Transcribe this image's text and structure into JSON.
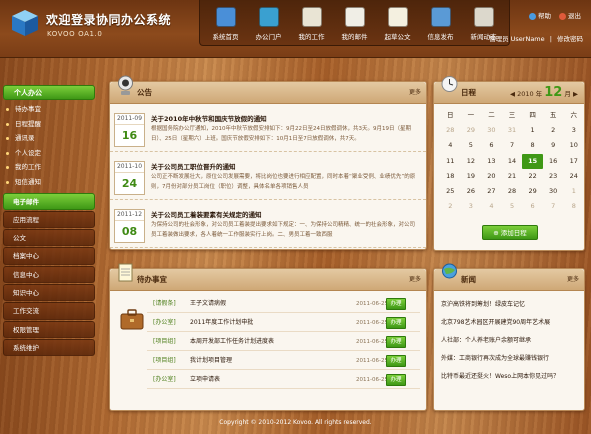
{
  "app": {
    "title": "欢迎登录协同办公系统",
    "subtitle": "KOVOO OA1.0"
  },
  "nav": [
    {
      "label": "系统首页",
      "icon": "monitor-icon",
      "color": "#4a8fd8"
    },
    {
      "label": "办公门户",
      "icon": "globe-icon",
      "color": "#3aa0d0"
    },
    {
      "label": "我的工作",
      "icon": "document-icon",
      "color": "#e9e4d4"
    },
    {
      "label": "我的邮件",
      "icon": "mail-icon",
      "color": "#f0eee6"
    },
    {
      "label": "起草公文",
      "icon": "edit-icon",
      "color": "#f4f0e0"
    },
    {
      "label": "信息发布",
      "icon": "phone-icon",
      "color": "#5a9ad6"
    },
    {
      "label": "新闻动态",
      "icon": "news-icon",
      "color": "#dcd8cc"
    }
  ],
  "top_links": {
    "help": "帮助",
    "exit": "退出"
  },
  "user": {
    "label": "管理员 UserName",
    "sep": "|",
    "change_password": "修改密码"
  },
  "sidebar": {
    "group_label": "个人办公",
    "sub_items": [
      "待办事宜",
      "日程提醒",
      "通讯录",
      "个人设定",
      "我的工作",
      "短信通知"
    ],
    "main_items": [
      {
        "label": "电子邮件",
        "active": true
      },
      {
        "label": "应用流程",
        "active": false
      },
      {
        "label": "公文",
        "active": false
      },
      {
        "label": "档案中心",
        "active": false
      },
      {
        "label": "信息中心",
        "active": false
      },
      {
        "label": "知识中心",
        "active": false
      },
      {
        "label": "工作交流",
        "active": false
      },
      {
        "label": "权限管理",
        "active": false
      },
      {
        "label": "系统维护",
        "active": false
      }
    ]
  },
  "notice": {
    "title": "公告",
    "more": "更多",
    "items": [
      {
        "ym": "2011-09",
        "day": "16",
        "title": "关于2010年中秋节和国庆节放假的通知",
        "body": "根据国务院办公厅通知，2010年中秋节放假安排如下：9月22日至24日放假调休，共3天。9月19日（星期日）、25日（星期六）上班。国庆节放假安排如下：10月1日至7日放假调休，共7天。"
      },
      {
        "ym": "2011-10",
        "day": "24",
        "title": "关于公司员工职位晋升的通知",
        "body": "公司正不断发展壮大，原位公司发展需要，将比岗位也要进行相应配置，同时本着“聚业受例、业绩优先”的原则，7月份对部分员工岗位（职位）调整，具体名单各项销售人员"
      },
      {
        "ym": "2011-12",
        "day": "08",
        "title": "关于公司员工着装要素有关规定的通知",
        "body": "为保持公司的社会形象，对公司员工着装提出要求如下规定：一、为保持公司精精、统一的社会形象，对公司员工着装做出要求，各人着统一工作服装实行上岗。二、男员工着一致西服"
      }
    ]
  },
  "calendar": {
    "title": "日程",
    "year_label": "2010 年",
    "month": "12",
    "month_suffix": "月",
    "weekdays": [
      "日",
      "一",
      "二",
      "三",
      "四",
      "五",
      "六"
    ],
    "weeks": [
      [
        {
          "d": "28",
          "dim": true
        },
        {
          "d": "29",
          "dim": true
        },
        {
          "d": "30",
          "dim": true
        },
        {
          "d": "31",
          "dim": true
        },
        {
          "d": "1"
        },
        {
          "d": "2"
        },
        {
          "d": "3"
        }
      ],
      [
        {
          "d": "4"
        },
        {
          "d": "5"
        },
        {
          "d": "6"
        },
        {
          "d": "7"
        },
        {
          "d": "8"
        },
        {
          "d": "9"
        },
        {
          "d": "10"
        }
      ],
      [
        {
          "d": "11"
        },
        {
          "d": "12"
        },
        {
          "d": "13"
        },
        {
          "d": "14"
        },
        {
          "d": "15",
          "today": true
        },
        {
          "d": "16"
        },
        {
          "d": "17"
        }
      ],
      [
        {
          "d": "18"
        },
        {
          "d": "19"
        },
        {
          "d": "20"
        },
        {
          "d": "21"
        },
        {
          "d": "22"
        },
        {
          "d": "23"
        },
        {
          "d": "24"
        }
      ],
      [
        {
          "d": "25"
        },
        {
          "d": "26"
        },
        {
          "d": "27"
        },
        {
          "d": "28"
        },
        {
          "d": "29"
        },
        {
          "d": "30"
        },
        {
          "d": "1",
          "dim": true
        }
      ],
      [
        {
          "d": "2",
          "dim": true
        },
        {
          "d": "3",
          "dim": true
        },
        {
          "d": "4",
          "dim": true
        },
        {
          "d": "5",
          "dim": true
        },
        {
          "d": "6",
          "dim": true
        },
        {
          "d": "7",
          "dim": true
        },
        {
          "d": "8",
          "dim": true
        }
      ]
    ],
    "add_button": "添加日程"
  },
  "todo": {
    "title": "待办事宜",
    "more": "更多",
    "items": [
      {
        "cat": "[请假条]",
        "title": "王子文请病假",
        "date": "2011-06-25",
        "action": "办理"
      },
      {
        "cat": "[办公室]",
        "title": "2011年度工作计划申批",
        "date": "2011-06-25",
        "action": "办理"
      },
      {
        "cat": "[项目组]",
        "title": "本周开发部工作任务计划进度表",
        "date": "2011-06-25",
        "action": "办理"
      },
      {
        "cat": "[项目组]",
        "title": "我计划项目管理",
        "date": "2011-06-25",
        "action": "办理"
      },
      {
        "cat": "[办公室]",
        "title": "立项申请表",
        "date": "2011-06-25",
        "action": "办理"
      }
    ]
  },
  "news": {
    "title": "新闻",
    "more": "更多",
    "items": [
      "京沪高铁将到筹划！绿皮车记忆",
      "北京798艺术园区开展建党90周年艺术展",
      "人社部：个人养老账户余额可继承",
      "外媒：工商银行再次成为全球最赚钱银行",
      "比特币最近还挺火！Weso上网本你见过吗？"
    ]
  },
  "footer": "Copyright © 2010-2012 Kovoo. All rights reserved."
}
